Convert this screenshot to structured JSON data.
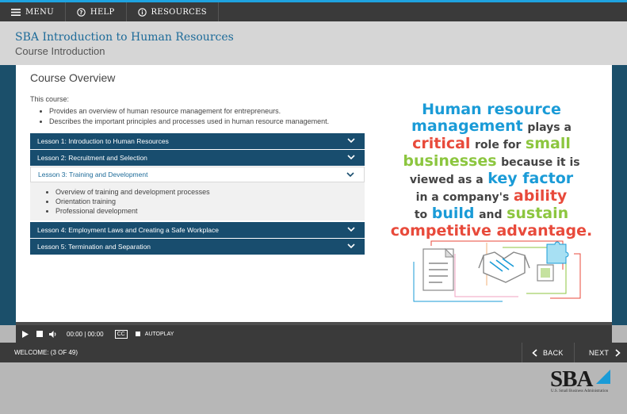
{
  "topbar": {
    "menu_label": "MENU",
    "help_label": "HELP",
    "resources_label": "RESOURCES"
  },
  "header": {
    "title": "SBA Introduction to Human Resources",
    "subtitle": "Course Introduction"
  },
  "slide": {
    "heading": "Course Overview",
    "intro": "This course:",
    "bullets": [
      "Provides an overview of human resource management for entrepreneurs.",
      "Describes the important principles and processes used in human resource management."
    ],
    "lessons": [
      {
        "label": "Lesson 1: Introduction to Human Resources"
      },
      {
        "label": "Lesson 2: Recruitment and Selection"
      },
      {
        "label": "Lesson 3: Training and Development",
        "expanded": true,
        "items": [
          "Overview of training and development processes",
          "Orientation training",
          "Professional development"
        ]
      },
      {
        "label": "Lesson 4: Employment Laws and Creating a Safe Workplace"
      },
      {
        "label": "Lesson 5: Termination and Separation"
      }
    ],
    "quote": {
      "w1": "Human resource",
      "w2": "management",
      "w3": "plays a",
      "w4": "critical",
      "w5": "role for",
      "w6": "small",
      "w7": "businesses",
      "w8": "because it is",
      "w9": "viewed as a",
      "w10": "key factor",
      "w11": "in a company's",
      "w12": "ability",
      "w13": "to",
      "w14": "build",
      "w15": "and",
      "w16": "sustain",
      "w17": "competitive advantage."
    },
    "illustration_icons": [
      "document-icon",
      "handshake-icon",
      "puzzle-icon"
    ]
  },
  "player": {
    "time": "00:00 | 00:00",
    "cc_label": "CC",
    "autoplay_label": "AUTOPLAY"
  },
  "nav": {
    "progress": "WELCOME: (3 OF 49)",
    "back_label": "BACK",
    "next_label": "NEXT"
  },
  "logo": {
    "text": "SBA",
    "tagline": "U.S. Small Business Administration"
  },
  "colors": {
    "accent_blue": "#1fa3e0",
    "navy": "#184d6e",
    "quote_blue": "#1a9bd7",
    "quote_red": "#e84a3b",
    "quote_green": "#8cc63f"
  }
}
